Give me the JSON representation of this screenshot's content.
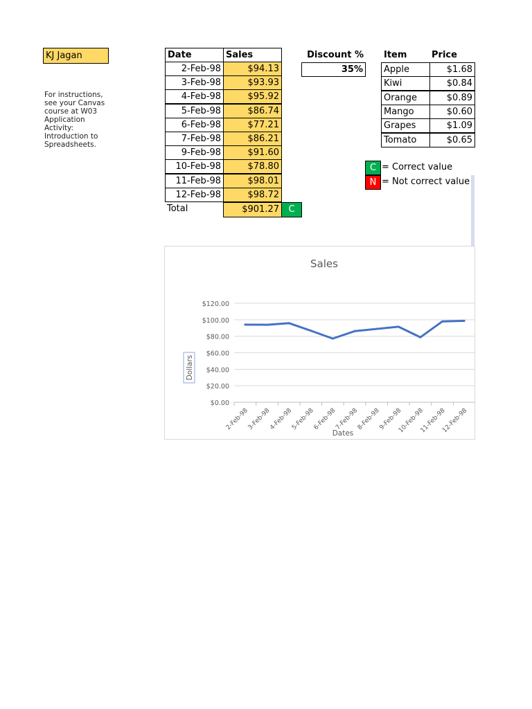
{
  "name_cell": "KJ Jagan",
  "instructions": "For instructions, see your Canvas course at W03 Application Activity: Introduction to Spreadsheets.",
  "sales_table": {
    "headers": [
      "Date",
      "Sales"
    ],
    "rows": [
      [
        "2-Feb-98",
        "$94.13"
      ],
      [
        "3-Feb-98",
        "$93.93"
      ],
      [
        "4-Feb-98",
        "$95.92"
      ],
      [
        "5-Feb-98",
        "$86.74"
      ],
      [
        "6-Feb-98",
        "$77.21"
      ],
      [
        "7-Feb-98",
        "$86.21"
      ],
      [
        "9-Feb-98",
        "$91.60"
      ],
      [
        "10-Feb-98",
        "$78.80"
      ],
      [
        "11-Feb-98",
        "$98.01"
      ],
      [
        "12-Feb-98",
        "$98.72"
      ]
    ],
    "total_label": "Total",
    "total_value": "$901.27",
    "total_check": "C"
  },
  "discount": {
    "label": "Discount %",
    "value": "35%"
  },
  "price_table": {
    "headers": [
      "Item",
      "Price"
    ],
    "rows": [
      [
        "Apple",
        "$1.68"
      ],
      [
        "Kiwi",
        "$0.84"
      ],
      [
        "Orange",
        "$0.89"
      ],
      [
        "Mango",
        "$0.60"
      ],
      [
        "Grapes",
        "$1.09"
      ],
      [
        "Tomato",
        "$0.65"
      ]
    ]
  },
  "legend": {
    "correct": {
      "badge": "C",
      "text": "= Correct value",
      "color": "#00b050"
    },
    "incorrect": {
      "badge": "N",
      "text": "= Not correct value",
      "color": "#ff0000"
    }
  },
  "chart_data": {
    "type": "line",
    "title": "Sales",
    "xlabel": "Dates",
    "ylabel": "Dollars",
    "categories": [
      "2-Feb-98",
      "3-Feb-98",
      "4-Feb-98",
      "5-Feb-98",
      "6-Feb-98",
      "7-Feb-98",
      "8-Feb-98",
      "9-Feb-98",
      "10-Feb-98",
      "11-Feb-98",
      "12-Feb-98"
    ],
    "values": [
      94.13,
      93.93,
      95.92,
      86.74,
      77.21,
      86.21,
      88.9,
      91.6,
      78.8,
      98.01,
      98.72
    ],
    "yticks": [
      "$0.00",
      "$20.00",
      "$40.00",
      "$60.00",
      "$80.00",
      "$100.00",
      "$120.00"
    ],
    "ylim": [
      0,
      120
    ],
    "grid": true,
    "line_color": "#4472c4"
  }
}
